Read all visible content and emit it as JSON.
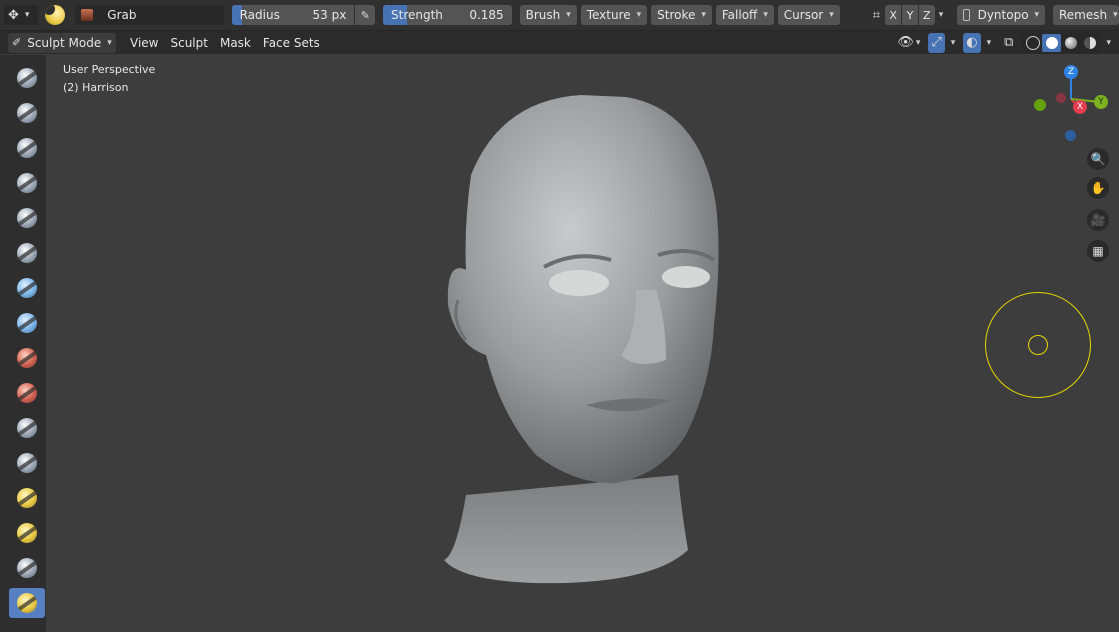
{
  "toolbar": {
    "brush_name": "Grab",
    "radius_label": "Radius",
    "radius_value": "53 px",
    "strength_label": "Strength",
    "strength_value": "0.185",
    "strength_fill_fraction": 0.185,
    "menus": [
      "Brush",
      "Texture",
      "Stroke",
      "Falloff",
      "Cursor"
    ],
    "symmetry": [
      "X",
      "Y",
      "Z"
    ],
    "dyntopo_label": "Dyntopo",
    "remesh_label": "Remesh"
  },
  "modebar": {
    "mode_label": "Sculpt Mode",
    "menus": [
      "View",
      "Sculpt",
      "Mask",
      "Face Sets"
    ]
  },
  "viewport": {
    "perspective_label": "User Perspective",
    "object_label": "(2) Harrison"
  },
  "gizmo": {
    "z": "Z",
    "x": "X",
    "y": "Y"
  },
  "colors": {
    "accent": "#4772b3",
    "brush_cursor": "#e6d700",
    "background": "#3d3d3d"
  },
  "tools": [
    "draw",
    "draw-sharp",
    "clay",
    "clay-strips",
    "clay-thumb",
    "layer",
    "inflate",
    "blob",
    "crease",
    "smooth",
    "flatten",
    "fill",
    "scrape",
    "multiplane-scrape",
    "pinch",
    "grab"
  ]
}
